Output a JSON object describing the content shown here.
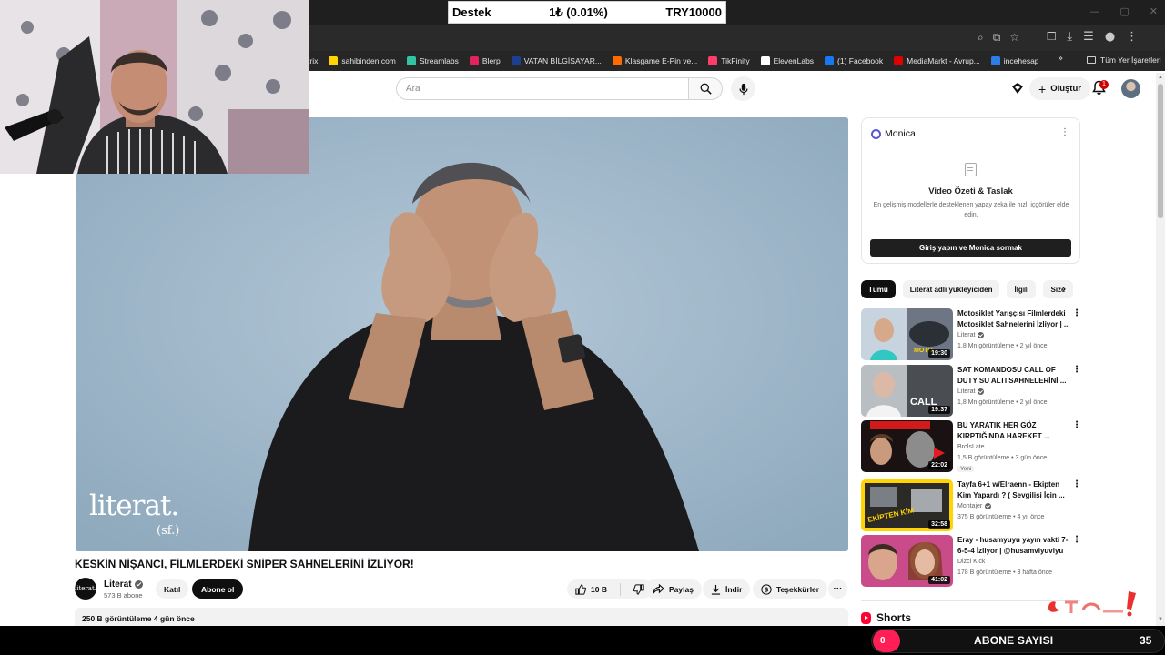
{
  "donation": {
    "label": "Destek",
    "amount": "1₺ (0.01%)",
    "goal": "TRY10000"
  },
  "bookmarks": {
    "items": [
      {
        "label": "trix",
        "color": "#cccccc"
      },
      {
        "label": "sahibinden.com",
        "color": "#ffd400"
      },
      {
        "label": "Streamlabs",
        "color": "#31c3a2"
      },
      {
        "label": "Blerp",
        "color": "#e0245e"
      },
      {
        "label": "VATAN BİLGİSAYAR...",
        "color": "#1c3f94"
      },
      {
        "label": "Klasgame E-Pin ve...",
        "color": "#ff6a00"
      },
      {
        "label": "TikFinity",
        "color": "#ff3d6b"
      },
      {
        "label": "ElevenLabs",
        "color": "#ffffff"
      },
      {
        "label": "(1) Facebook",
        "color": "#1877f2"
      },
      {
        "label": "MediaMarkt - Avrup...",
        "color": "#df0000"
      },
      {
        "label": "incehesap",
        "color": "#2b7de9"
      }
    ],
    "all_label": "Tüm Yer İşaretleri"
  },
  "header": {
    "search_placeholder": "Ara",
    "create_label": "Oluştur",
    "notification_count": "1"
  },
  "video": {
    "title": "KESKİN NİŞANCI, FİLMLERDEKİ SNİPER SAHNELERİNİ İZLİYOR!",
    "watermark": "literat.",
    "watermark_sub": "(sf.)",
    "channel": {
      "name": "Literat",
      "avatar_text": "literat.",
      "subscribers": "573 B abone"
    },
    "join_label": "Katıl",
    "subscribe_label": "Abone ol",
    "likes": "10 B",
    "share_label": "Paylaş",
    "download_label": "İndir",
    "thanks_label": "Teşekkürler",
    "views_and_date": "250 B görüntüleme  4 gün önce"
  },
  "monica": {
    "brand": "Monica",
    "title": "Video Özeti & Taslak",
    "description": "En gelişmiş modellerle desteklenen yapay zeka ile hızlı içgörüler elde edin.",
    "button_label": "Giriş yapın ve Monica sormak"
  },
  "chips": [
    "Tümü",
    "Literat adlı yükleyiciden",
    "İlgili",
    "Size"
  ],
  "recommended": [
    {
      "title": "Motosiklet Yarışçısı Filmlerdeki Motosiklet Sahnelerini İzliyor | ...",
      "channel": "Literat",
      "verified": true,
      "meta": "1,8 Mn görüntüleme • 2 yıl önce",
      "duration": "19:30",
      "badge": ""
    },
    {
      "title": "SAT KOMANDOSU CALL OF DUTY SU ALTI SAHNELERİNİ ...",
      "channel": "Literat",
      "verified": true,
      "meta": "1,8 Mn görüntüleme • 2 yıl önce",
      "duration": "19:37",
      "badge": ""
    },
    {
      "title": "BU YARATIK HER GÖZ KIRPTIĞINDA HAREKET ...",
      "channel": "BrolsLate",
      "verified": false,
      "meta": "1,5 B görüntüleme • 3 gün önce",
      "duration": "22:02",
      "badge": "Yeni"
    },
    {
      "title": "Tayfa 6+1 w/Elraenn - Ekipten Kim Yapardı ? ( Sevgilisi İçin ...",
      "channel": "Montajer",
      "verified": true,
      "meta": "375 B görüntüleme • 4 yıl önce",
      "duration": "32:58",
      "badge": ""
    },
    {
      "title": "Eray - husamyuyu yayın vakti 7-6-5-4 İzliyor | @husamviyuviyu",
      "channel": "Dizci Kick",
      "verified": false,
      "meta": "178 B görüntüleme • 3 hafta önce",
      "duration": "41:02",
      "badge": ""
    }
  ],
  "shorts_label": "Shorts",
  "overlay": {
    "subscriber_label": "ABONE SAYISI",
    "subscriber_start": "0",
    "subscriber_count": "35"
  },
  "colors": {
    "accent": "#ff0033",
    "counter_pink": "#ff1f56",
    "chrome_dark": "#1f1f1f"
  }
}
